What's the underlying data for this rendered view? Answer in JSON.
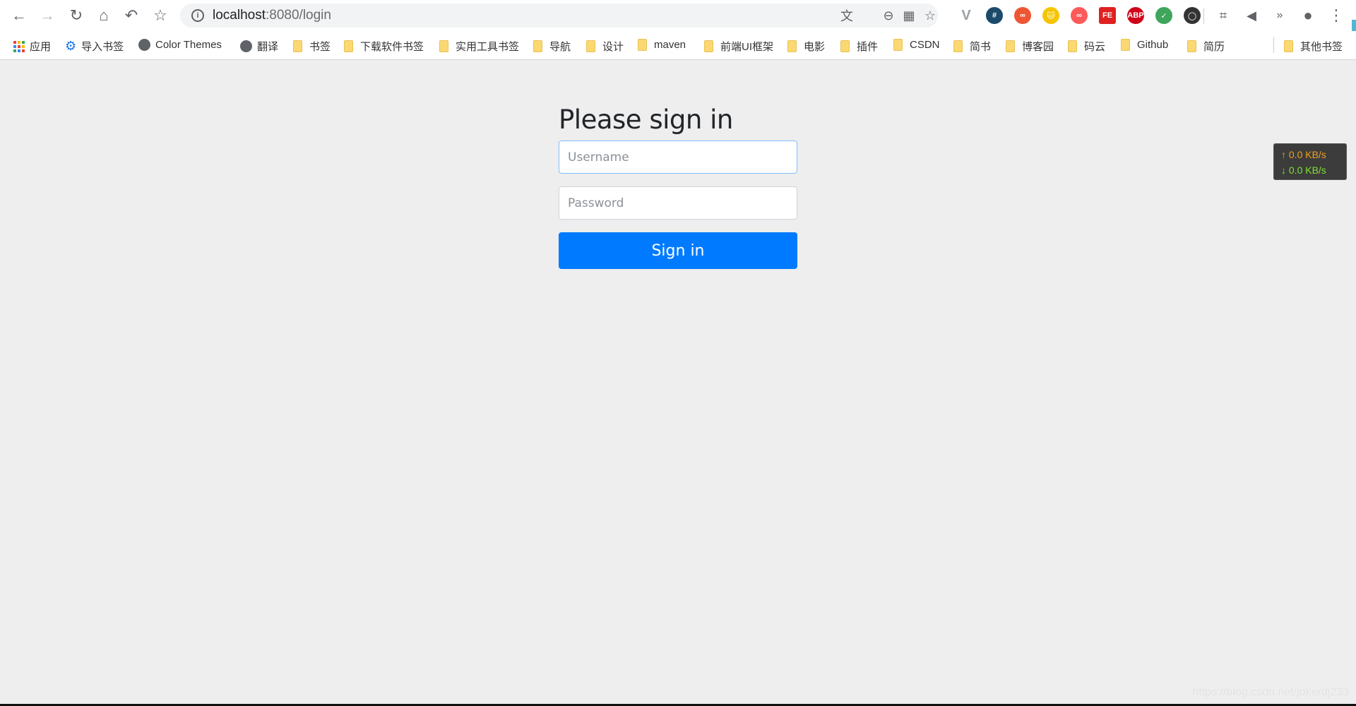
{
  "browser": {
    "url_host": "localhost",
    "url_rest": ":8080/login",
    "nav_icons": [
      "back-icon",
      "forward-icon",
      "reload-icon",
      "home-icon",
      "undo-icon",
      "star-icon"
    ],
    "omnibox_icons": [
      "translate-icon",
      "zoom-out-icon",
      "qr-code-icon",
      "bookmark-star-icon"
    ],
    "extensions": [
      {
        "name": "vue-devtools",
        "glyph": "V",
        "color": "#9aa0a6"
      },
      {
        "name": "hashtag",
        "glyph": "#",
        "color": "#1b4a6b"
      },
      {
        "name": "infinity-red",
        "glyph": "∞",
        "color": "#ee5533"
      },
      {
        "name": "tampermonkey-cat",
        "glyph": "🐱",
        "color": "#f5c400"
      },
      {
        "name": "infinity-pink",
        "glyph": "∞",
        "color": "#ff5a5a"
      },
      {
        "name": "fe-helper",
        "glyph": "FE",
        "color": "#e02020"
      },
      {
        "name": "adblock-plus",
        "glyph": "ABP",
        "color": "#d0021b"
      },
      {
        "name": "shield-check",
        "glyph": "✓",
        "color": "#3ea55c"
      },
      {
        "name": "ring",
        "glyph": "◯",
        "color": "#333333"
      }
    ],
    "right_icons": [
      "crop-icon",
      "mute-icon",
      "more-extensions-icon",
      "profile-icon",
      "menu-icon"
    ]
  },
  "bookmarks": [
    {
      "label": "应用",
      "icon": "apps"
    },
    {
      "label": "导入书签",
      "icon": "gear"
    },
    {
      "label": "Color Themes",
      "icon": "globe"
    },
    {
      "label": "翻译",
      "icon": "globe"
    },
    {
      "label": "书签",
      "icon": "folder"
    },
    {
      "label": "下载软件书签",
      "icon": "folder"
    },
    {
      "label": "实用工具书签",
      "icon": "folder"
    },
    {
      "label": "导航",
      "icon": "folder"
    },
    {
      "label": "设计",
      "icon": "folder"
    },
    {
      "label": "maven",
      "icon": "folder"
    },
    {
      "label": "前端UI框架",
      "icon": "folder"
    },
    {
      "label": "电影",
      "icon": "folder"
    },
    {
      "label": "插件",
      "icon": "folder"
    },
    {
      "label": "CSDN",
      "icon": "folder"
    },
    {
      "label": "简书",
      "icon": "folder"
    },
    {
      "label": "博客园",
      "icon": "folder"
    },
    {
      "label": "码云",
      "icon": "folder"
    },
    {
      "label": "Github",
      "icon": "folder"
    },
    {
      "label": "简历",
      "icon": "folder"
    }
  ],
  "other_bookmarks": "其他书签",
  "login": {
    "title": "Please sign in",
    "username_placeholder": "Username",
    "password_placeholder": "Password",
    "submit_label": "Sign in",
    "accent": "#007bff"
  },
  "net_monitor": {
    "upload": "0.0 KB/s",
    "download": "0.0 KB/s"
  },
  "watermark": "https://blog.csdn.net/jokerdj233"
}
